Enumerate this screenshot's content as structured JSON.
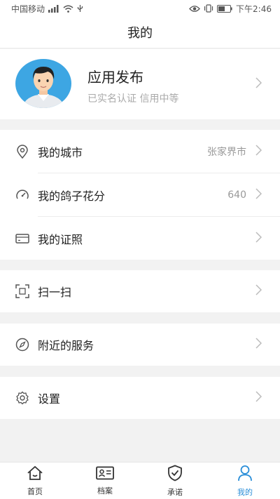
{
  "status_bar": {
    "carrier": "中国移动",
    "time": "下午2:46"
  },
  "header": {
    "title": "我的"
  },
  "profile": {
    "name": "应用发布",
    "status": "已实名认证 信用中等"
  },
  "menu": {
    "city": {
      "label": "我的城市",
      "value": "张家界市",
      "icon": "location-pin-icon"
    },
    "score": {
      "label": "我的鸽子花分",
      "value": "640",
      "icon": "gauge-icon"
    },
    "license": {
      "label": "我的证照",
      "icon": "card-icon"
    },
    "scan": {
      "label": "扫一扫",
      "icon": "scan-icon"
    },
    "nearby": {
      "label": "附近的服务",
      "icon": "compass-icon"
    },
    "settings": {
      "label": "设置",
      "icon": "gear-icon"
    }
  },
  "tabs": [
    {
      "label": "首页",
      "icon": "home-icon"
    },
    {
      "label": "档案",
      "icon": "id-card-icon"
    },
    {
      "label": "承诺",
      "icon": "shield-check-icon"
    },
    {
      "label": "我的",
      "icon": "person-icon"
    }
  ],
  "colors": {
    "accent": "#2a8ed8",
    "background": "#f2f2f2"
  }
}
